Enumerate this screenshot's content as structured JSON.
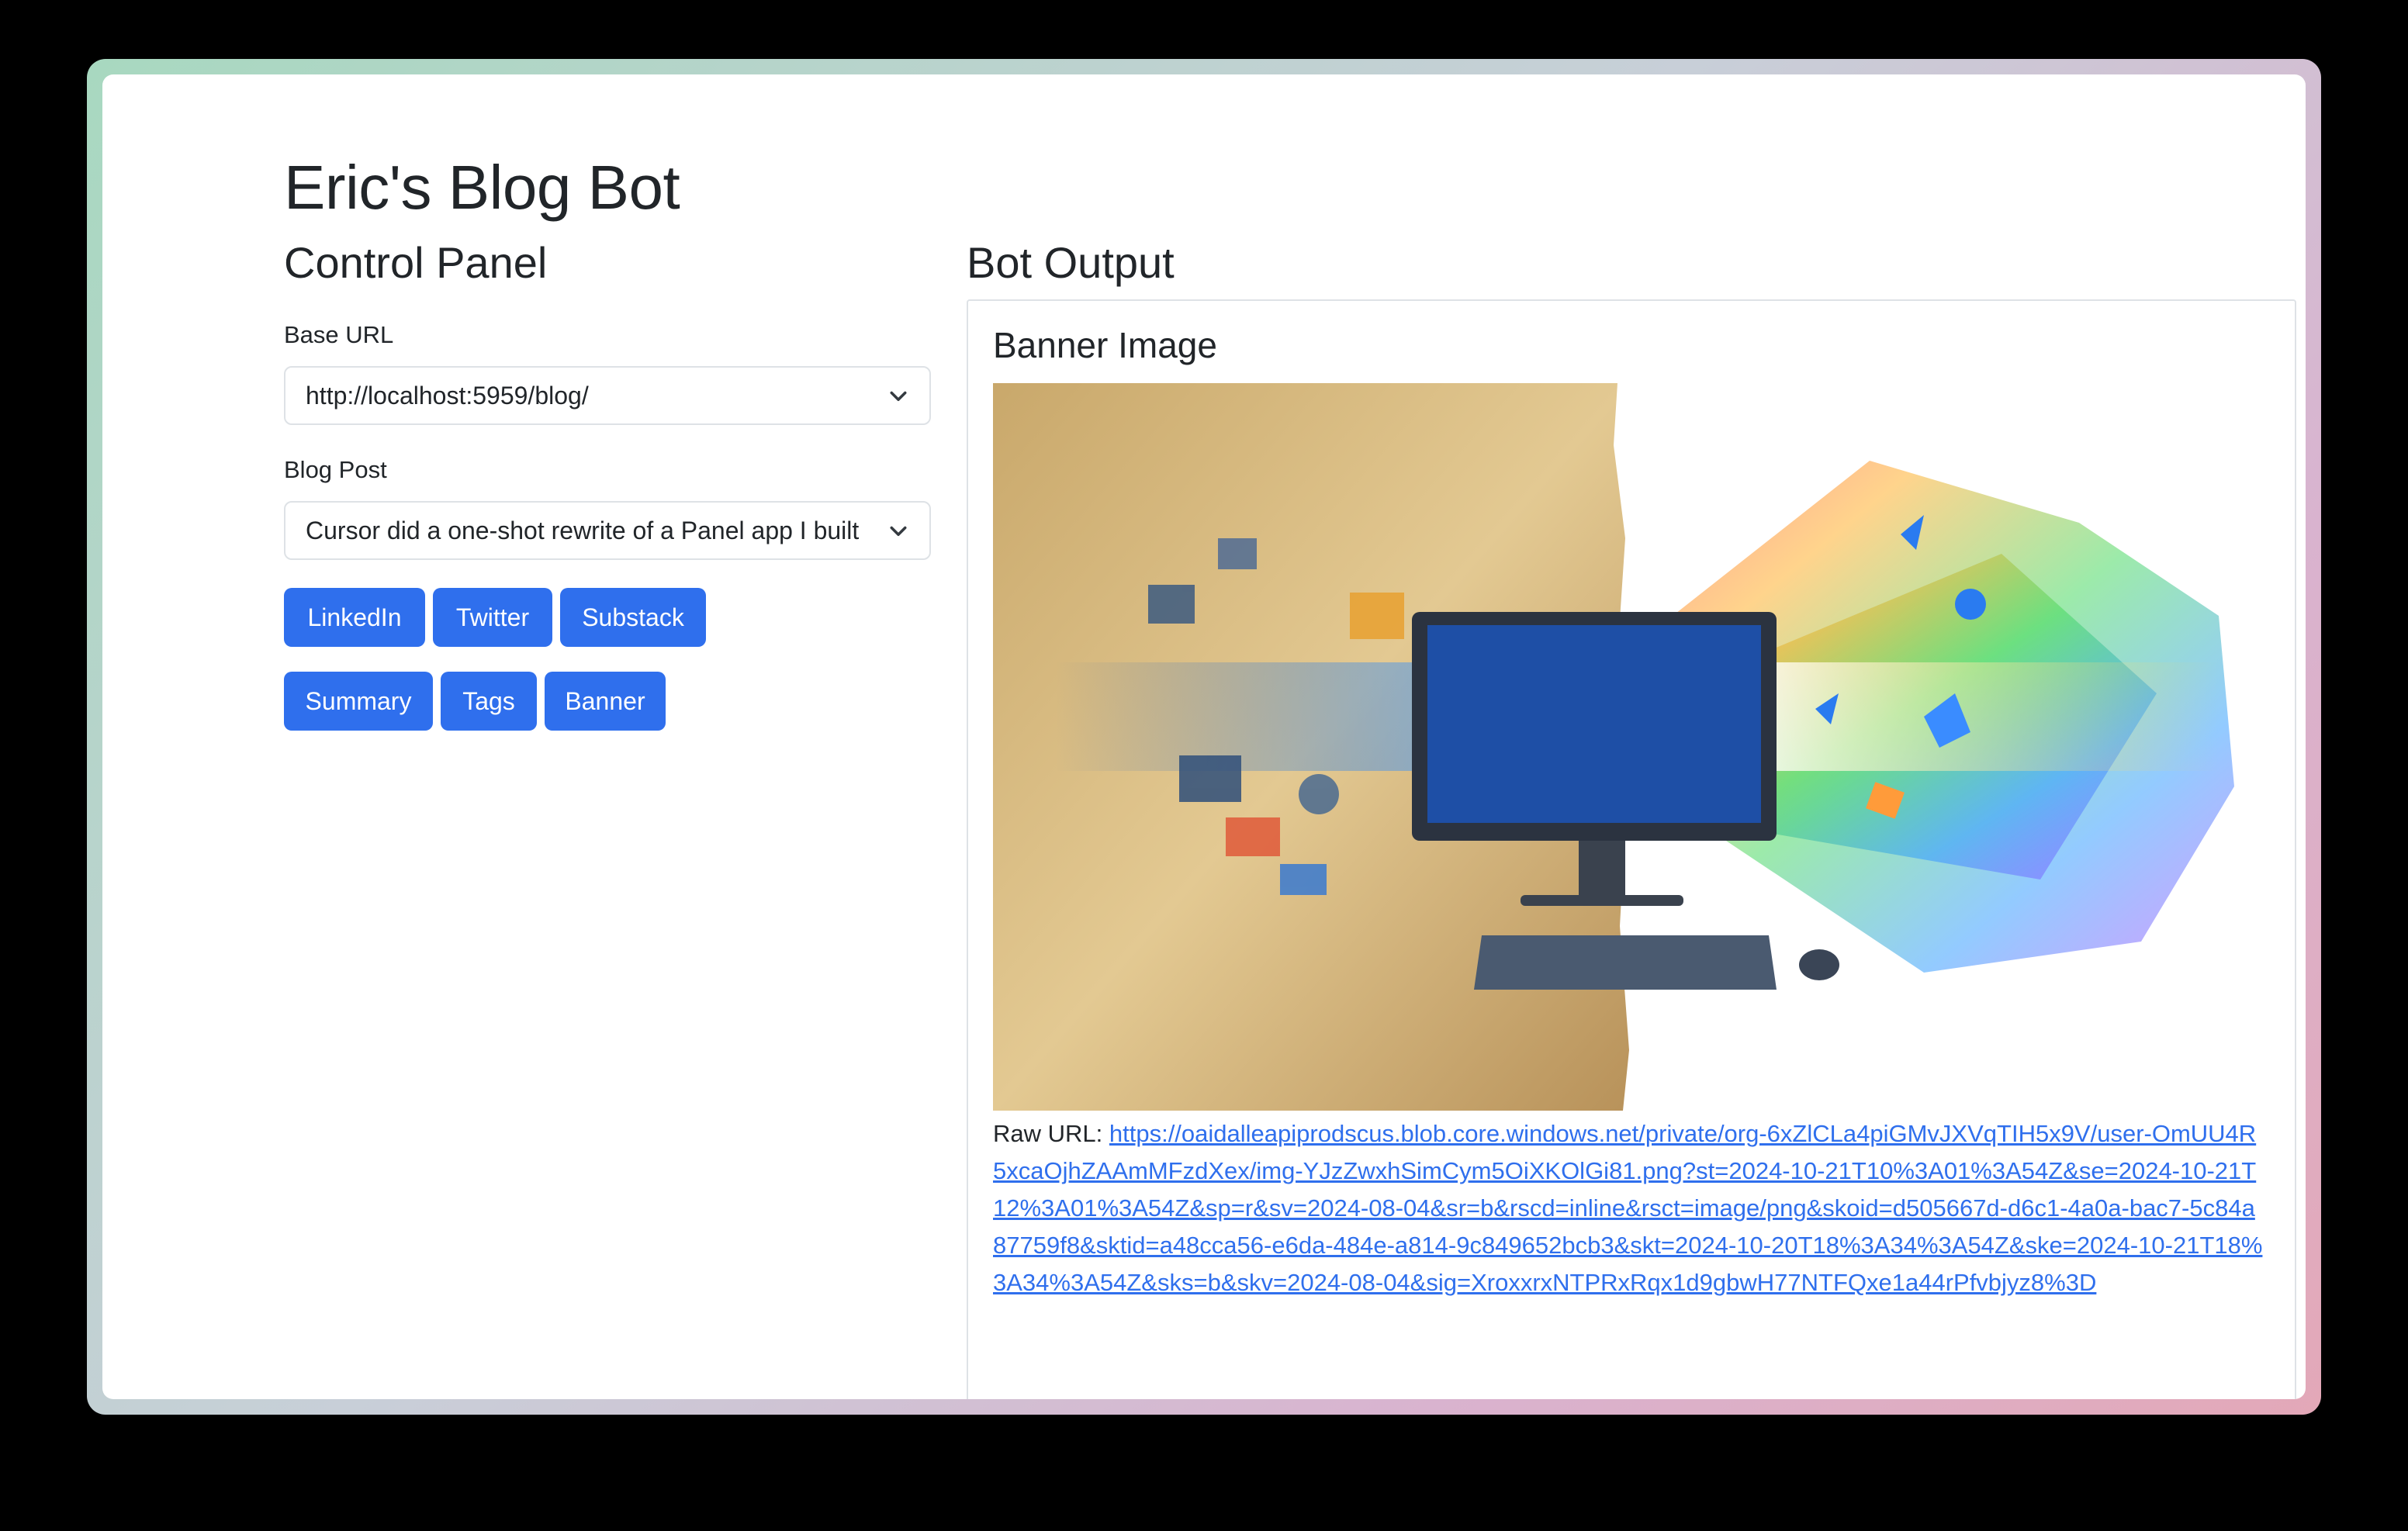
{
  "app": {
    "title": "Eric's Blog Bot"
  },
  "control_panel": {
    "title": "Control Panel",
    "base_url": {
      "label": "Base URL",
      "value": "http://localhost:5959/blog/"
    },
    "blog_post": {
      "label": "Blog Post",
      "value": "Cursor did a one-shot rewrite of a Panel app I built"
    },
    "buttons_row1": [
      "LinkedIn",
      "Twitter",
      "Substack"
    ],
    "buttons_row2": [
      "Summary",
      "Tags",
      "Banner"
    ]
  },
  "bot_output": {
    "title": "Bot Output",
    "banner_heading": "Banner Image",
    "raw_url_label": "Raw URL: ",
    "raw_url": "https://oaidalleapiprodscus.blob.core.windows.net/private/org-6xZlCLa4piGMvJXVqTIH5x9V/user-OmUU4R5xcaOjhZAAmMFzdXex/img-YJzZwxhSimCym5OiXKOlGi81.png?st=2024-10-21T10%3A01%3A54Z&se=2024-10-21T12%3A01%3A54Z&sp=r&sv=2024-08-04&sr=b&rscd=inline&rsct=image/png&skoid=d505667d-d6c1-4a0a-bac7-5c84a87759f8&sktid=a48cca56-e6da-484e-a814-9c849652bcb3&skt=2024-10-20T18%3A34%3A54Z&ske=2024-10-21T18%3A34%3A54Z&sks=b&skv=2024-08-04&sig=XroxxrxNTPRxRqx1d9gbwH77NTFQxe1a44rPfvbjyz8%3D"
  }
}
